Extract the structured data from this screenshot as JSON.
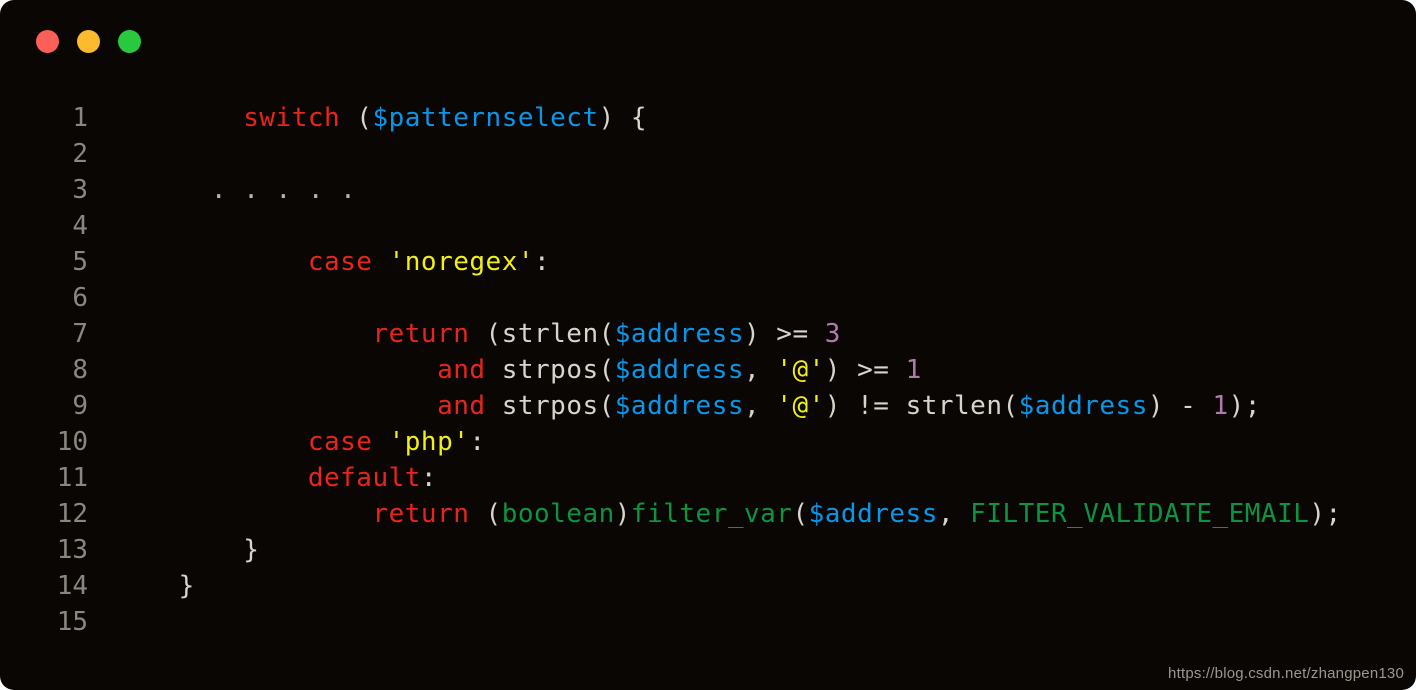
{
  "window": {
    "title_bar": {
      "dots": [
        {
          "name": "close-dot",
          "label": "close",
          "color": "#fb5f58"
        },
        {
          "name": "minimize-dot",
          "label": "minimize",
          "color": "#fcbb2e"
        },
        {
          "name": "maximize-dot",
          "label": "maximize",
          "color": "#28c83f"
        }
      ]
    },
    "background": "#0a0604",
    "watermark": "https://blog.csdn.net/zhangpen130"
  },
  "editor": {
    "language": "php",
    "line_number_color": "#8b8680",
    "default_text_color": "#d8d4cc",
    "palette": {
      "keyword": "#e8251c",
      "variable": "#0a96e8",
      "string": "#f2ef14",
      "number": "#b07aae",
      "function": "#0d9440",
      "punctuation": "#d8d4cc"
    },
    "lines": [
      {
        "number": "1",
        "tokens": [
          {
            "c": "plain",
            "t": "        "
          },
          {
            "c": "kw",
            "t": "switch"
          },
          {
            "c": "plain",
            "t": " ("
          },
          {
            "c": "var",
            "t": "$patternselect"
          },
          {
            "c": "plain",
            "t": ") {"
          }
        ]
      },
      {
        "number": "2",
        "tokens": []
      },
      {
        "number": "3",
        "tokens": [
          {
            "c": "plain",
            "t": "      "
          },
          {
            "c": "dots",
            "t": ". . . . ."
          }
        ]
      },
      {
        "number": "4",
        "tokens": []
      },
      {
        "number": "5",
        "tokens": [
          {
            "c": "plain",
            "t": "            "
          },
          {
            "c": "kw",
            "t": "case"
          },
          {
            "c": "plain",
            "t": " "
          },
          {
            "c": "str",
            "t": "'noregex'"
          },
          {
            "c": "plain",
            "t": ":"
          }
        ]
      },
      {
        "number": "6",
        "tokens": []
      },
      {
        "number": "7",
        "tokens": [
          {
            "c": "plain",
            "t": "                "
          },
          {
            "c": "kw",
            "t": "return"
          },
          {
            "c": "plain",
            "t": " (strlen("
          },
          {
            "c": "var",
            "t": "$address"
          },
          {
            "c": "plain",
            "t": ") >= "
          },
          {
            "c": "num",
            "t": "3"
          }
        ]
      },
      {
        "number": "8",
        "tokens": [
          {
            "c": "plain",
            "t": "                    "
          },
          {
            "c": "kw",
            "t": "and"
          },
          {
            "c": "plain",
            "t": " strpos("
          },
          {
            "c": "var",
            "t": "$address"
          },
          {
            "c": "plain",
            "t": ", "
          },
          {
            "c": "str",
            "t": "'@'"
          },
          {
            "c": "plain",
            "t": ") >= "
          },
          {
            "c": "num",
            "t": "1"
          }
        ]
      },
      {
        "number": "9",
        "tokens": [
          {
            "c": "plain",
            "t": "                    "
          },
          {
            "c": "kw",
            "t": "and"
          },
          {
            "c": "plain",
            "t": " strpos("
          },
          {
            "c": "var",
            "t": "$address"
          },
          {
            "c": "plain",
            "t": ", "
          },
          {
            "c": "str",
            "t": "'@'"
          },
          {
            "c": "plain",
            "t": ") != strlen("
          },
          {
            "c": "var",
            "t": "$address"
          },
          {
            "c": "plain",
            "t": ") - "
          },
          {
            "c": "num",
            "t": "1"
          },
          {
            "c": "plain",
            "t": ");"
          }
        ]
      },
      {
        "number": "10",
        "tokens": [
          {
            "c": "plain",
            "t": "            "
          },
          {
            "c": "kw",
            "t": "case"
          },
          {
            "c": "plain",
            "t": " "
          },
          {
            "c": "str",
            "t": "'php'"
          },
          {
            "c": "plain",
            "t": ":"
          }
        ]
      },
      {
        "number": "11",
        "tokens": [
          {
            "c": "plain",
            "t": "            "
          },
          {
            "c": "kw",
            "t": "default"
          },
          {
            "c": "plain",
            "t": ":"
          }
        ]
      },
      {
        "number": "12",
        "tokens": [
          {
            "c": "plain",
            "t": "                "
          },
          {
            "c": "kw",
            "t": "return"
          },
          {
            "c": "plain",
            "t": " ("
          },
          {
            "c": "type",
            "t": "boolean"
          },
          {
            "c": "plain",
            "t": ")"
          },
          {
            "c": "fn",
            "t": "filter_var"
          },
          {
            "c": "plain",
            "t": "("
          },
          {
            "c": "var",
            "t": "$address"
          },
          {
            "c": "plain",
            "t": ", "
          },
          {
            "c": "const",
            "t": "FILTER_VALIDATE_EMAIL"
          },
          {
            "c": "plain",
            "t": ");"
          }
        ]
      },
      {
        "number": "13",
        "tokens": [
          {
            "c": "plain",
            "t": "        }"
          }
        ]
      },
      {
        "number": "14",
        "tokens": [
          {
            "c": "plain",
            "t": "    }"
          }
        ]
      },
      {
        "number": "15",
        "tokens": []
      }
    ]
  }
}
